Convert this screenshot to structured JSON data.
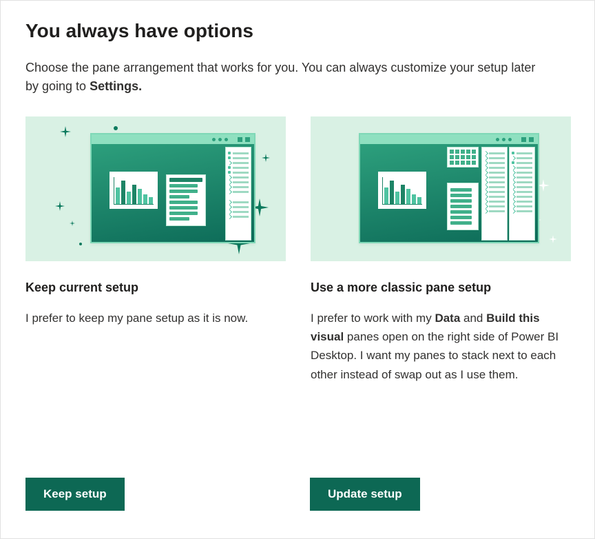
{
  "header": {
    "title": "You always have options",
    "description_pre": "Choose the pane arrangement that works for you. You can always customize your setup later by going to ",
    "description_bold": "Settings.",
    "description_post": ""
  },
  "options": {
    "keep": {
      "title": "Keep current setup",
      "body_pre": "I prefer to keep my pane setup as it is now.",
      "button_label": "Keep setup"
    },
    "classic": {
      "title": "Use a more classic pane setup",
      "body_pre": "I prefer to work with my ",
      "body_bold1": "Data",
      "body_mid1": " and ",
      "body_bold2": "Build this visual",
      "body_post": " panes open on the right side of Power BI Desktop. I want my panes to stack next to each other instead of swap out as I use them.",
      "button_label": "Update setup"
    }
  },
  "colors": {
    "accent": "#0d6854",
    "illustration_bg": "#d9f1e4"
  }
}
